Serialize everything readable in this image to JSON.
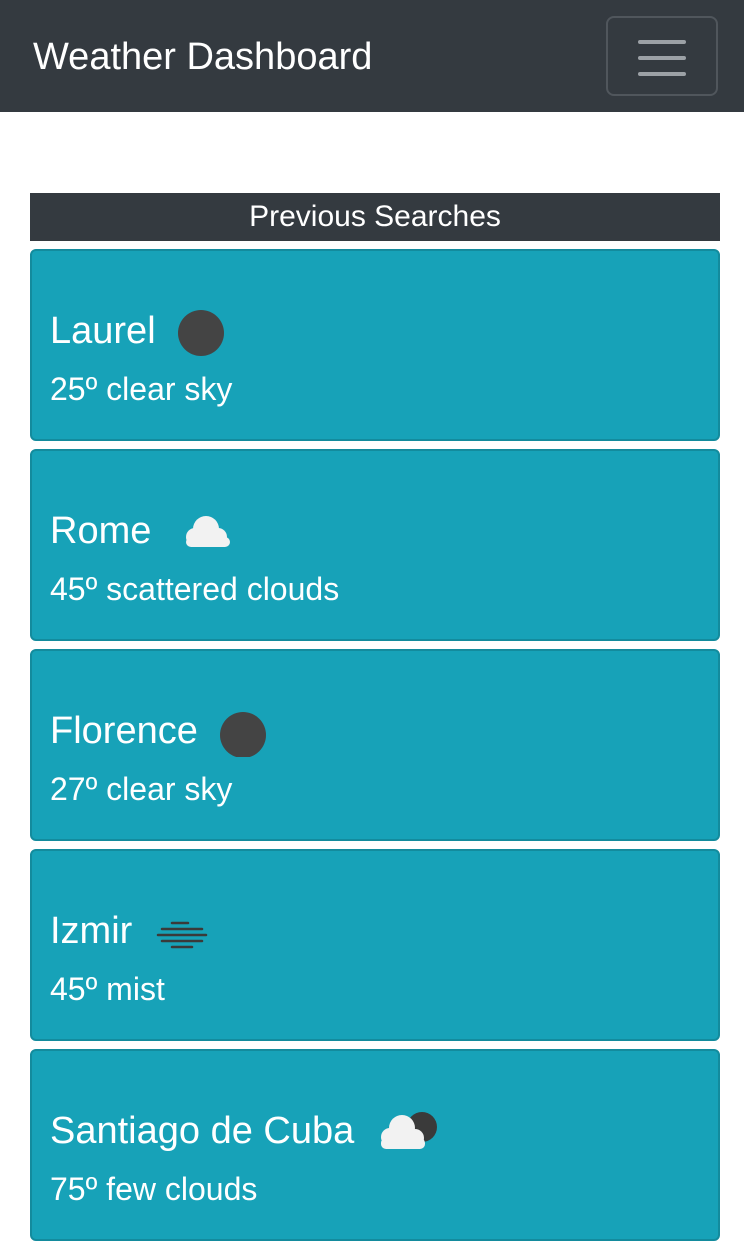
{
  "navbar": {
    "brand": "Weather Dashboard",
    "toggle_icon": "hamburger-menu-icon"
  },
  "previous_searches": {
    "heading": "Previous Searches",
    "items": [
      {
        "city": "Laurel",
        "temp": "25º",
        "description": "clear sky",
        "icon": "clear-sky-night-icon"
      },
      {
        "city": "Rome",
        "temp": "45º",
        "description": "scattered clouds",
        "icon": "cloud-icon"
      },
      {
        "city": "Florence",
        "temp": "27º",
        "description": "clear sky",
        "icon": "clear-sky-night-icon"
      },
      {
        "city": "Izmir",
        "temp": "45º",
        "description": "mist",
        "icon": "mist-icon"
      },
      {
        "city": "Santiago de Cuba",
        "temp": "75º",
        "description": "few clouds",
        "icon": "few-clouds-night-icon"
      }
    ]
  },
  "colors": {
    "navbar": "#343a40",
    "card": "#17a2b8",
    "text": "#ffffff",
    "moon": "#444444"
  }
}
